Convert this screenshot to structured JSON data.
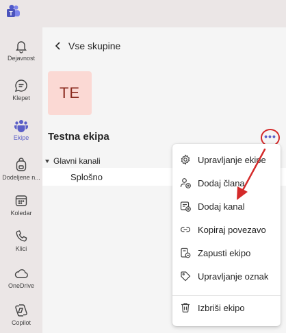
{
  "titlebar": {
    "logo_icon": "teams-logo-icon"
  },
  "rail": {
    "items": [
      {
        "label": "Dejavnost",
        "icon": "bell-icon"
      },
      {
        "label": "Klepet",
        "icon": "chat-icon"
      },
      {
        "label": "Ekipe",
        "icon": "teams-icon",
        "active": true
      },
      {
        "label": "Dodeljene n...",
        "icon": "backpack-icon"
      },
      {
        "label": "Koledar",
        "icon": "calendar-icon"
      },
      {
        "label": "Klici",
        "icon": "phone-icon"
      },
      {
        "label": "OneDrive",
        "icon": "cloud-icon"
      },
      {
        "label": "Copilot",
        "icon": "copilot-icon"
      }
    ]
  },
  "main": {
    "back_label": "Vse skupine",
    "team_initials": "TE",
    "team_name": "Testna ekipa",
    "more_label": "•••",
    "channels_header": "Glavni kanali",
    "channels": [
      {
        "label": "Splošno"
      }
    ]
  },
  "menu": {
    "items": [
      {
        "label": "Upravljanje ekipe",
        "icon": "gear-icon"
      },
      {
        "label": "Dodaj člana",
        "icon": "add-person-icon"
      },
      {
        "label": "Dodaj kanal",
        "icon": "add-channel-icon"
      },
      {
        "label": "Kopiraj povezavo",
        "icon": "link-icon"
      },
      {
        "label": "Zapusti ekipo",
        "icon": "leave-icon"
      },
      {
        "label": "Upravljanje oznak",
        "icon": "tag-icon"
      },
      {
        "label": "Izbriši ekipo",
        "icon": "trash-icon"
      }
    ]
  },
  "colors": {
    "accent": "#5b5fc7",
    "annotation": "#d42a2a",
    "avatar_bg": "#fbd9d4",
    "avatar_text": "#8a2a1e",
    "rail_bg": "#ebe6e6"
  }
}
